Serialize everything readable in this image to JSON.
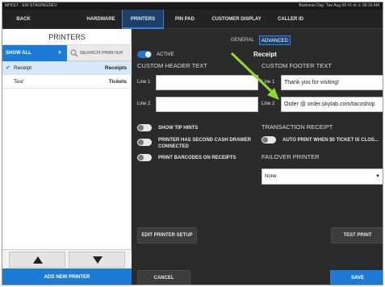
{
  "statusbar": {
    "left_text": "MHOLT · EW STAGING/DEV",
    "right_text": "Business Day: Tue Aug 09   #1   ✉   ⚠   09:16 AM"
  },
  "topnav": {
    "back": "BACK",
    "hardware": "HARDWARE",
    "printers": "PRINTERS",
    "pin_pad": "PIN PAD",
    "customer_display": "CUSTOMER DISPLAY",
    "caller_id": "CALLER ID"
  },
  "left": {
    "title": "PRINTERS",
    "filter": "SHOW ALL",
    "search_placeholder": "SEARCH PRINTER",
    "printers": [
      {
        "check": "✔",
        "name": "Receipt",
        "type": "Receipts"
      },
      {
        "check": "",
        "name": "Test",
        "type": "Tickets"
      }
    ],
    "add_button": "ADD NEW PRINTER"
  },
  "right": {
    "tabs": {
      "general": "GENERAL",
      "advanced": "ADVANCED"
    },
    "active_label": "ACTIVE",
    "printer_name": "Receipt",
    "custom_header_title": "CUSTOM HEADER TEXT",
    "custom_footer_title": "CUSTOM FOOTER TEXT",
    "line1_label": "Line 1",
    "line2_label": "Line 2",
    "header_line1": "",
    "header_line2": "",
    "footer_line1": "Thank you for visiting!",
    "footer_line2": "Order @ order.skytab.com/tacoshop",
    "show_tip_hints": "SHOW TIP HINTS",
    "second_cash_drawer": "PRINTER HAS SECOND CASH DRAWER CONNECTED",
    "print_barcodes": "PRINT BARCODES ON RECEIPTS",
    "transaction_receipt_title": "TRANSACTION RECEIPT",
    "auto_print": "AUTO PRINT WHEN $0 TICKET IS CLOS...",
    "failover_title": "FAILOVER PRINTER",
    "failover_value": "None",
    "edit_setup": "EDIT PRINTER SETUP",
    "test_print": "TEST PRINT",
    "cancel": "CANCEL",
    "save": "SAVE"
  },
  "colors": {
    "accent": "#1c7bd6",
    "background": "#2b2b2b",
    "annotation_arrow": "#8fd82e"
  }
}
